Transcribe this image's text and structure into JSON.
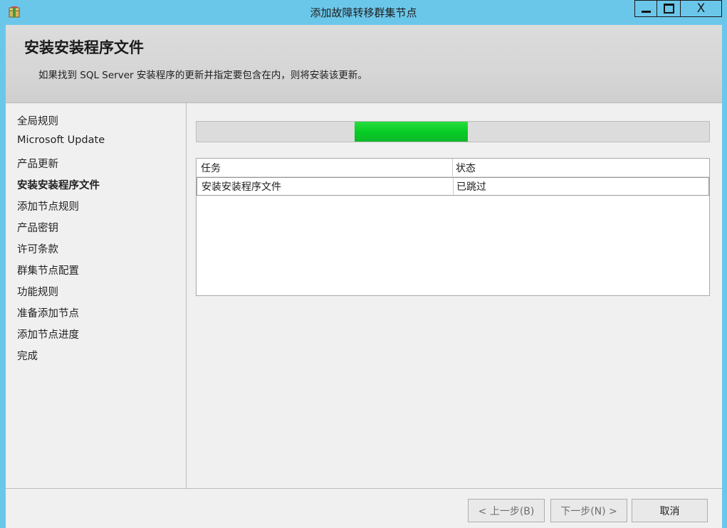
{
  "window": {
    "title": "添加故障转移群集节点",
    "icon": "setup-box-icon",
    "controls": {
      "minimize_icon": "minimize-icon",
      "maximize_icon": "maximize-icon",
      "close_label": "X"
    }
  },
  "header": {
    "title": "安装安装程序文件",
    "description": "如果找到 SQL Server 安装程序的更新并指定要包含在内，则将安装该更新。"
  },
  "sidebar": {
    "items": [
      {
        "label": "全局规则"
      },
      {
        "label": "Microsoft Update"
      },
      {
        "label": "产品更新"
      },
      {
        "label": "安装安装程序文件",
        "active": true
      },
      {
        "label": "添加节点规则"
      },
      {
        "label": "产品密钥"
      },
      {
        "label": "许可条款"
      },
      {
        "label": "群集节点配置"
      },
      {
        "label": "功能规则"
      },
      {
        "label": "准备添加节点"
      },
      {
        "label": "添加节点进度"
      },
      {
        "label": "完成"
      }
    ]
  },
  "progress": {
    "indeterminate": true,
    "accent_color": "#06cb24"
  },
  "task_table": {
    "columns": [
      "任务",
      "状态"
    ],
    "rows": [
      {
        "task": "安装安装程序文件",
        "status": "已跳过"
      }
    ]
  },
  "footer": {
    "back_label": "< 上一步(B)",
    "next_label": "下一步(N) >",
    "cancel_label": "取消"
  },
  "colors": {
    "titlebar": "#6bc7ea",
    "client_bg": "#f0f0f0"
  }
}
